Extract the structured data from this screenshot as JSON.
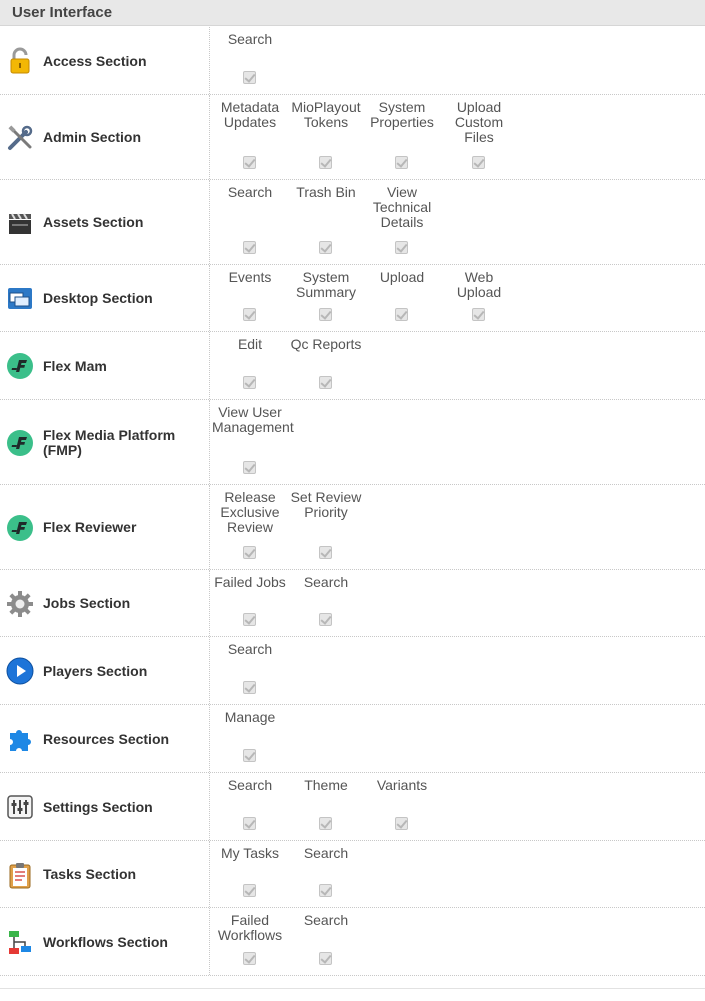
{
  "header": {
    "title": "User Interface"
  },
  "colors": {
    "header_bg": "#e8e8e8",
    "checkbox": "#e6e6e6"
  },
  "sections": [
    {
      "name": "Access Section",
      "icon": "padlock-icon",
      "permissions": [
        "Search"
      ]
    },
    {
      "name": "Admin Section",
      "icon": "tools-icon",
      "permissions": [
        "Metadata Updates",
        "MioPlayout Tokens",
        "System Properties",
        "Upload Custom Files"
      ]
    },
    {
      "name": "Assets Section",
      "icon": "clapperboard-icon",
      "permissions": [
        "Search",
        "Trash Bin",
        "View Technical Details"
      ]
    },
    {
      "name": "Desktop Section",
      "icon": "desktop-windows-icon",
      "permissions": [
        "Events",
        "System Summary",
        "Upload",
        "Web Upload"
      ]
    },
    {
      "name": "Flex Mam",
      "icon": "flex-logo-icon",
      "permissions": [
        "Edit",
        "Qc Reports"
      ]
    },
    {
      "name": "Flex Media Platform (FMP)",
      "icon": "flex-logo-icon",
      "permissions": [
        "View User Management"
      ]
    },
    {
      "name": "Flex Reviewer",
      "icon": "flex-logo-icon",
      "permissions": [
        "Release Exclusive Review",
        "Set Review Priority"
      ]
    },
    {
      "name": "Jobs Section",
      "icon": "gear-icon",
      "permissions": [
        "Failed Jobs",
        "Search"
      ]
    },
    {
      "name": "Players Section",
      "icon": "play-icon",
      "permissions": [
        "Search"
      ]
    },
    {
      "name": "Resources Section",
      "icon": "puzzle-icon",
      "permissions": [
        "Manage"
      ]
    },
    {
      "name": "Settings Section",
      "icon": "sliders-icon",
      "permissions": [
        "Search",
        "Theme",
        "Variants"
      ]
    },
    {
      "name": "Tasks Section",
      "icon": "clipboard-icon",
      "permissions": [
        "My Tasks",
        "Search"
      ]
    },
    {
      "name": "Workflows Section",
      "icon": "workflow-icon",
      "permissions": [
        "Failed Workflows",
        "Search"
      ]
    }
  ]
}
